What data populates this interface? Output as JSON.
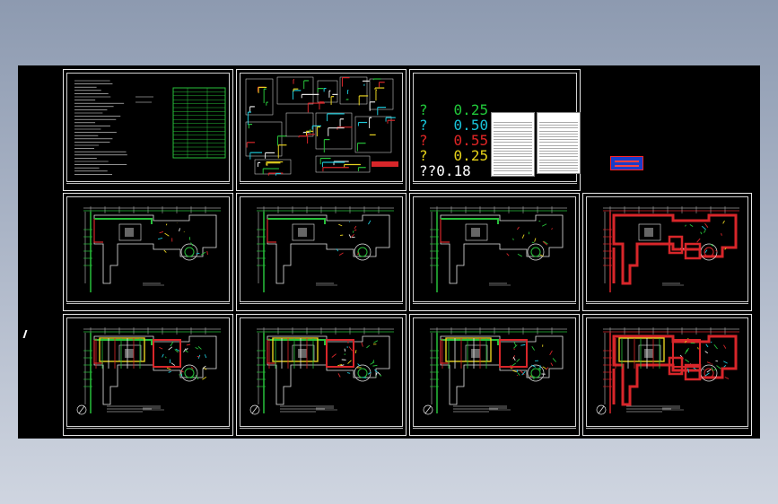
{
  "viewer": {
    "title": "",
    "background": [
      "#8d9ab0",
      "#cfd5e0"
    ]
  },
  "legend": {
    "rows": [
      {
        "mark": "?",
        "value": "0.25",
        "mark_color": "#21c83a",
        "value_color": "#21c83a"
      },
      {
        "mark": "?",
        "value": "0.50",
        "mark_color": "#19c2d8",
        "value_color": "#19c2d8"
      },
      {
        "mark": "?",
        "value": "0.55",
        "mark_color": "#e02525",
        "value_color": "#e02525"
      },
      {
        "mark": "?",
        "value": "0.25",
        "mark_color": "#e6d21a",
        "value_color": "#e6d21a"
      },
      {
        "mark": "??",
        "value": "0.18",
        "mark_color": "#ffffff",
        "value_color": "#ffffff"
      }
    ]
  },
  "colors": {
    "sheet_border": "#e8e8e8",
    "wall_green": "#27c13a",
    "wall_red": "#d8262a",
    "wall_yellow": "#e5d020",
    "wall_cyan": "#1ec7d8",
    "stamp_blue": "#1a3cc8"
  },
  "sheets": [
    {
      "id": "notes-sheet",
      "kind": "text"
    },
    {
      "id": "details-sheet",
      "kind": "details"
    },
    {
      "id": "legend-sheet",
      "kind": "legend"
    },
    {
      "id": "plan-1",
      "kind": "plan"
    },
    {
      "id": "plan-2",
      "kind": "plan"
    },
    {
      "id": "plan-3",
      "kind": "plan"
    },
    {
      "id": "plan-4",
      "kind": "plan-red"
    },
    {
      "id": "plan-5",
      "kind": "plan-dense"
    },
    {
      "id": "plan-6",
      "kind": "plan-dense"
    },
    {
      "id": "plan-7",
      "kind": "plan-dense"
    },
    {
      "id": "plan-8",
      "kind": "plan-red-dense"
    }
  ]
}
